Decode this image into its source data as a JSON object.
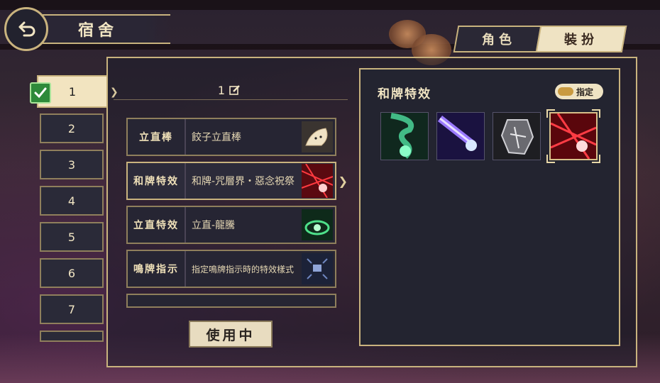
{
  "header": {
    "title": "宿舍"
  },
  "tabs": [
    {
      "label": "角色",
      "active": false
    },
    {
      "label": "裝扮",
      "active": true
    }
  ],
  "slots": [
    "1",
    "2",
    "3",
    "4",
    "5",
    "6",
    "7"
  ],
  "active_slot": "1",
  "slot_title": "1",
  "items": [
    {
      "category": "立直棒",
      "name": "餃子立直棒",
      "icon": "dumpling-stick-icon"
    },
    {
      "category": "和牌特效",
      "name": "和牌-咒層界・惡念祝祭",
      "icon": "red-burst-icon"
    },
    {
      "category": "立直特效",
      "name": "立直-龍騰",
      "icon": "green-dragon-icon"
    },
    {
      "category": "鳴牌指示",
      "name": "指定鳴牌指示時的特效樣式",
      "icon": "call-indicator-icon"
    }
  ],
  "use_button": "使用中",
  "right_panel": {
    "title": "和牌特效",
    "assign_label": "指定",
    "effects": [
      {
        "icon": "green-tornado-icon",
        "color": "#2fb070"
      },
      {
        "icon": "purple-beam-icon",
        "color": "#7a4ae0"
      },
      {
        "icon": "grey-shatter-icon",
        "color": "#9a9a9a"
      },
      {
        "icon": "red-burst-icon",
        "color": "#e0202a",
        "selected": true
      }
    ]
  },
  "colors": {
    "accent_gold": "#c9b37e",
    "panel_dark": "#232430",
    "cream": "#efe3c3"
  }
}
